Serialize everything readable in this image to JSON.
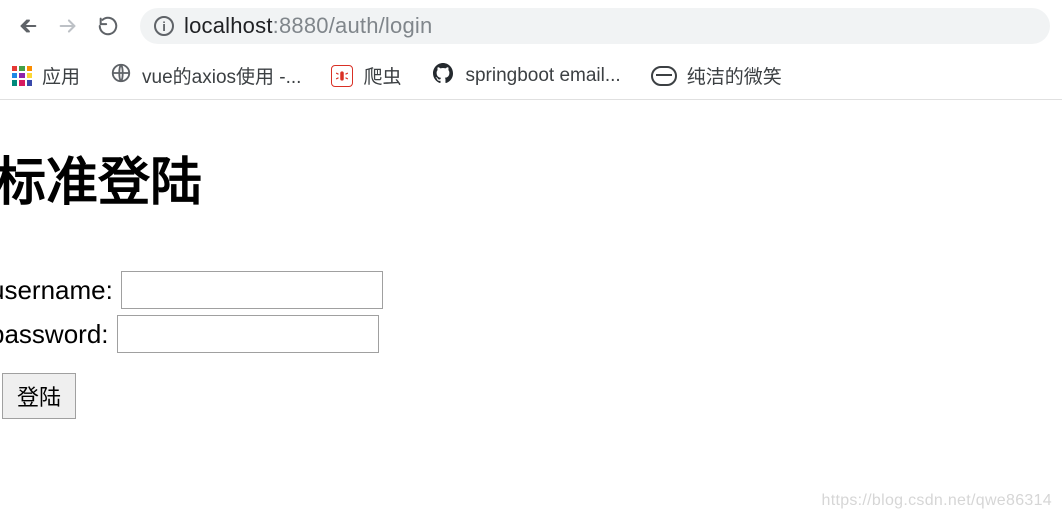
{
  "browser": {
    "url_host": "localhost",
    "url_port_path": ":8880/auth/login"
  },
  "bookmarks": {
    "apps": "应用",
    "vue_axios": "vue的axios使用 -...",
    "crawler": "爬虫",
    "springboot": "springboot email...",
    "pure_smile": "纯洁的微笑"
  },
  "page": {
    "title": "标准登陆",
    "username_label": "username:",
    "password_label": "password:",
    "username_value": "",
    "password_value": "",
    "login_button": "登陆"
  },
  "watermark": "https://blog.csdn.net/qwe86314"
}
